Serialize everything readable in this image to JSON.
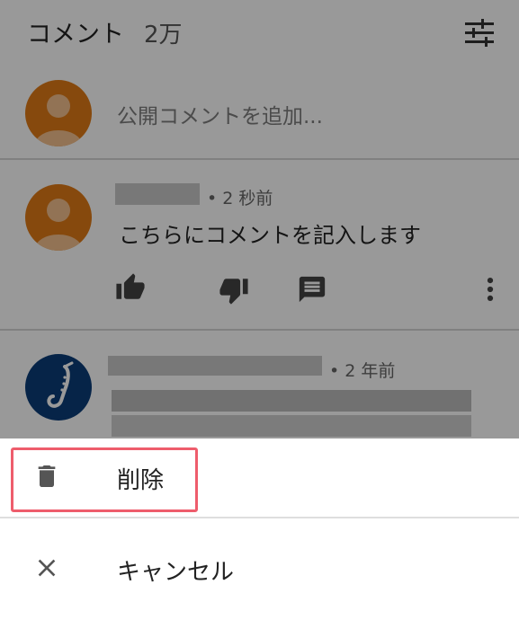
{
  "header": {
    "title": "コメント",
    "count": "2万"
  },
  "add_comment": {
    "placeholder": "公開コメントを追加..."
  },
  "comments": [
    {
      "meta": "• 2 秒前",
      "text": "こちらにコメントを記入します"
    },
    {
      "meta": "• 2 年前"
    }
  ],
  "sheet": {
    "delete_label": "削除",
    "cancel_label": "キャンセル"
  },
  "colors": {
    "avatar_orange": "#e07b17",
    "avatar_navy": "#0b3d78",
    "highlight_border": "#ee5d6c",
    "overlay": "rgba(0,0,0,0.40)"
  },
  "icons": [
    "filter-icon",
    "thumbs-up-icon",
    "thumbs-down-icon",
    "reply-icon",
    "more-vert-icon",
    "saxophone-icon",
    "trash-icon",
    "close-icon"
  ]
}
